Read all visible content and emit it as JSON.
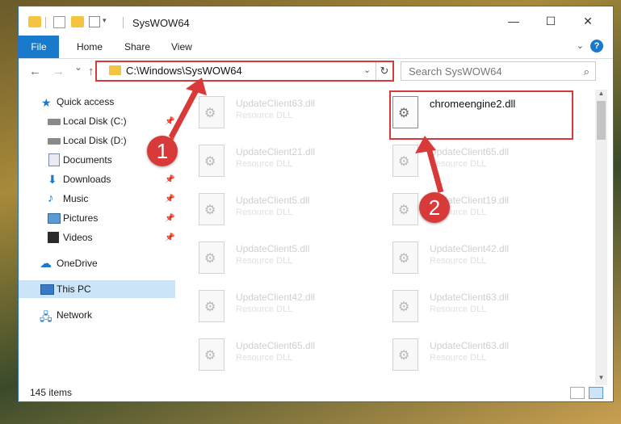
{
  "window": {
    "title": "SysWOW64",
    "controls": {
      "minimize": "—",
      "maximize": "☐",
      "close": "✕"
    }
  },
  "ribbon": {
    "tabs": [
      {
        "label": "File"
      },
      {
        "label": "Home"
      },
      {
        "label": "Share"
      },
      {
        "label": "View"
      }
    ],
    "expand_icon": "chevron-down-icon",
    "help_label": "?"
  },
  "navigation": {
    "back": "←",
    "forward": "→",
    "recent": "⌄",
    "up": "↑",
    "address": "C:\\Windows\\SysWOW64",
    "search_placeholder": "Search SysWOW64"
  },
  "sidebar": {
    "items": [
      {
        "label": "Quick access",
        "icon": "star-icon"
      },
      {
        "label": "Local Disk (C:)",
        "icon": "disk-icon",
        "pinned": true
      },
      {
        "label": "Local Disk (D:)",
        "icon": "disk-icon",
        "pinned": true
      },
      {
        "label": "Documents",
        "icon": "documents-icon",
        "pinned": true
      },
      {
        "label": "Downloads",
        "icon": "downloads-icon",
        "pinned": true
      },
      {
        "label": "Music",
        "icon": "music-icon",
        "pinned": true
      },
      {
        "label": "Pictures",
        "icon": "pictures-icon",
        "pinned": true
      },
      {
        "label": "Videos",
        "icon": "videos-icon",
        "pinned": true
      },
      {
        "label": "OneDrive",
        "icon": "onedrive-icon"
      },
      {
        "label": "This PC",
        "icon": "pc-icon",
        "selected": true
      },
      {
        "label": "Network",
        "icon": "network-icon"
      }
    ]
  },
  "files": [
    {
      "name": "UpdateClient63.dll",
      "type": "Resource DLL"
    },
    {
      "name": "chromeengine2.dll",
      "type": "",
      "highlighted": true
    },
    {
      "name": "UpdateClient21.dll",
      "type": "Resource DLL"
    },
    {
      "name": "UpdateClient65.dll",
      "type": "Resource DLL"
    },
    {
      "name": "UpdateClient5.dll",
      "type": "Resource DLL"
    },
    {
      "name": "UpdateClient19.dll",
      "type": "Resource DLL"
    },
    {
      "name": "UpdateClient5.dll",
      "type": "Resource DLL"
    },
    {
      "name": "UpdateClient42.dll",
      "type": "Resource DLL"
    },
    {
      "name": "UpdateClient42.dll",
      "type": "Resource DLL"
    },
    {
      "name": "UpdateClient63.dll",
      "type": "Resource DLL"
    },
    {
      "name": "UpdateClient65.dll",
      "type": "Resource DLL"
    },
    {
      "name": "UpdateClient63.dll",
      "type": "Resource DLL"
    }
  ],
  "status": {
    "item_count": "145 items"
  },
  "annotations": {
    "step1": "1",
    "step2": "2",
    "color": "#d83a3a"
  }
}
